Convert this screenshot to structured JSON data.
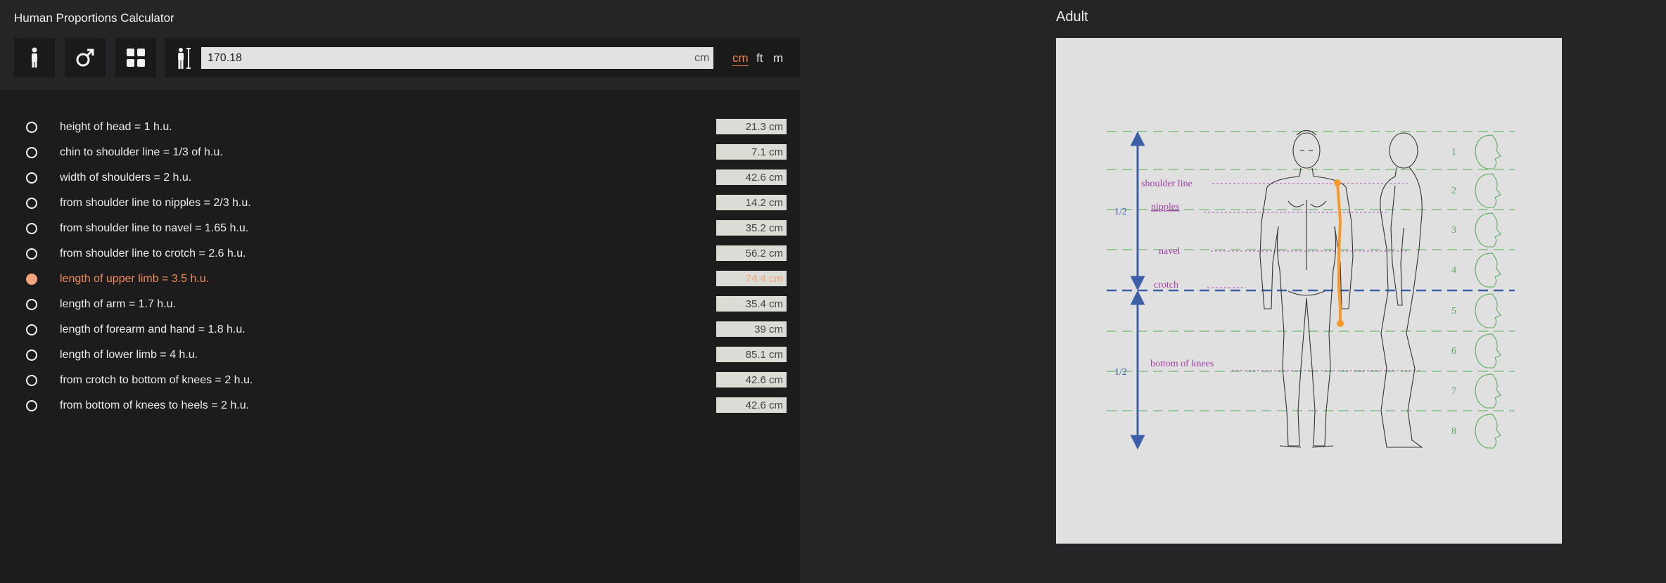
{
  "app": {
    "title": "Human Proportions Calculator"
  },
  "toolbar": {
    "buttons": [
      {
        "icon": "person-icon"
      },
      {
        "icon": "male-symbol-icon"
      },
      {
        "icon": "grid-icon"
      }
    ]
  },
  "height": {
    "icon": "height-measure-icon",
    "value": "170.18",
    "unit_suffix": "cm",
    "units": [
      "cm",
      "ft",
      "m"
    ],
    "selected_unit": "cm"
  },
  "colors": {
    "accent": "#f07f4f",
    "value_bg": "#dcdcd6"
  },
  "proportions": [
    {
      "label": "height of head = 1 h.u.",
      "value": "21.3 cm",
      "selected": false
    },
    {
      "label": "chin to shoulder line = 1/3 of h.u.",
      "value": "7.1 cm",
      "selected": false
    },
    {
      "label": "width of shoulders = 2 h.u.",
      "value": "42.6 cm",
      "selected": false
    },
    {
      "label": "from shoulder line to nipples = 2/3 h.u.",
      "value": "14.2 cm",
      "selected": false
    },
    {
      "label": "from shoulder line to navel = 1.65 h.u.",
      "value": "35.2 cm",
      "selected": false
    },
    {
      "label": "from shoulder line to crotch = 2.6 h.u.",
      "value": "56.2 cm",
      "selected": false
    },
    {
      "label": "length of upper limb = 3.5 h.u.",
      "value": "74.4 cm",
      "selected": true
    },
    {
      "label": "length of arm = 1.7 h.u.",
      "value": "35.4 cm",
      "selected": false
    },
    {
      "label": "length of forearm and hand = 1.8 h.u.",
      "value": "39 cm",
      "selected": false
    },
    {
      "label": "length of lower limb = 4 h.u.",
      "value": "85.1 cm",
      "selected": false
    },
    {
      "label": "from crotch to bottom of knees = 2 h.u.",
      "value": "42.6 cm",
      "selected": false
    },
    {
      "label": "from bottom of knees to heels = 2 h.u.",
      "value": "42.6 cm",
      "selected": false
    }
  ],
  "figure": {
    "title": "Adult",
    "half_label_top": "1/2",
    "half_label_bottom": "1/2",
    "line_labels": {
      "shoulder": "shoulder line",
      "nipples": "nipples",
      "navel": "navel",
      "crotch": "crotch",
      "knees": "bottom of knees"
    },
    "head_numbers": [
      "1",
      "2",
      "3",
      "4",
      "5",
      "6",
      "7",
      "8"
    ],
    "colors": {
      "green": "#55a855",
      "magenta": "#a33fa8",
      "blue": "#3d5fa8",
      "highlight": "#f59a2a"
    }
  }
}
